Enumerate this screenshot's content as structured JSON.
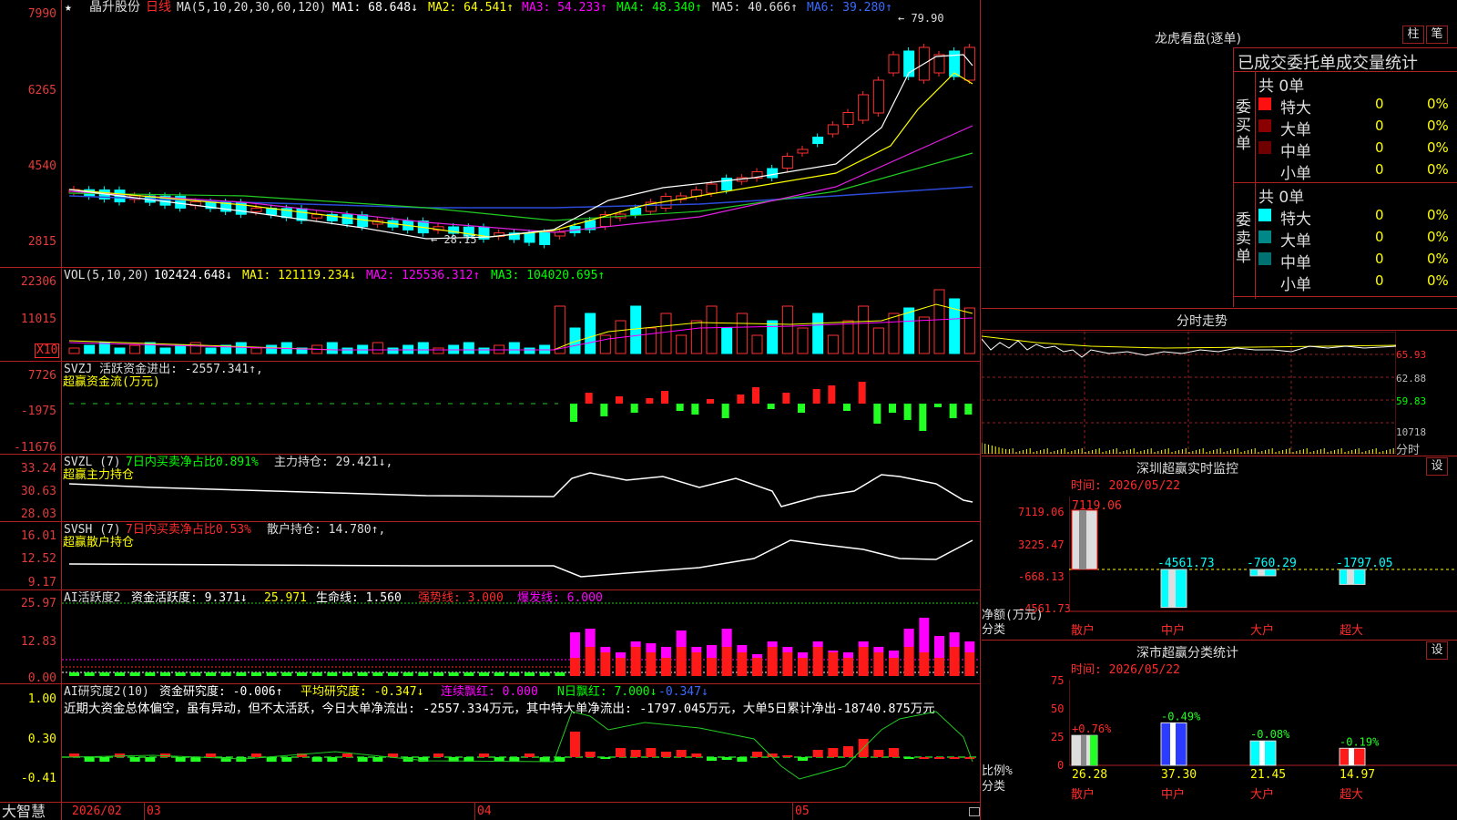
{
  "stock": {
    "name": "晶升股份",
    "period": "日线",
    "star": "★"
  },
  "ma_line": {
    "prefix": "MA(5,10,20,30,60,120)",
    "ma1": "MA1: 68.648↓",
    "ma2": "MA2: 64.541↑",
    "ma3": "MA3: 54.233↑",
    "ma4": "MA4: 48.340↑",
    "ma5": "MA5: 40.666↑",
    "ma6": "MA6: 39.280↑"
  },
  "price_axis": [
    "7990",
    "6265",
    "4540",
    "2815"
  ],
  "price_marks": {
    "high": "79.90",
    "low": "28.15"
  },
  "vol": {
    "header": "VOL(5,10,20)",
    "value": "102424.648↓",
    "ma1": "MA1: 121119.234↓",
    "ma2": "MA2: 125536.312↑",
    "ma3": "MA3: 104020.695↑",
    "axis": [
      "22306",
      "11015"
    ],
    "unit": "X10"
  },
  "svzj": {
    "header": "SVZJ  活跃资金进出: -2557.341↑,",
    "sub": "超赢资金流(万元)",
    "axis": [
      "7726",
      "-1975",
      "-11676"
    ]
  },
  "svzl": {
    "header": "SVZL (7)",
    "ratio": "7日内买卖净占比0.891%",
    "hold": "主力持仓: 29.421↓,",
    "sub": "超赢主力持仓",
    "axis": [
      "33.24",
      "30.63",
      "28.03"
    ]
  },
  "svsh": {
    "header": "SVSH (7)",
    "ratio": "7日内买卖净占比0.53%",
    "hold": "散户持仓: 14.780↑,",
    "sub": "超赢散户持仓",
    "axis": [
      "16.01",
      "12.52",
      "9.17"
    ]
  },
  "ai_active": {
    "header": "AI活跃度2",
    "a": "资金活跃度: 9.371↓",
    "b": "25.971",
    "c": "生命线: 1.560",
    "d": "强势线: 3.000",
    "e": "爆发线: 6.000",
    "axis": [
      "25.97",
      "12.83",
      "0.00"
    ]
  },
  "ai_research": {
    "header": "AI研究度2(10)",
    "a": "资金研究度: -0.006↑",
    "b": "平均研究度: -0.347↓",
    "c": "连续飘红: 0.000",
    "d": "N日飘红: 7.000↓",
    "e": "-0.347↓",
    "comment": "近期大资金总体偏空，虽有异动，但不太活跃，今日大单净流出: -2557.334万元，其中特大单净流出: -1797.045万元，大单5日累计净出-18740.875万元",
    "axis": [
      "1.00",
      "0.30",
      "-0.41"
    ]
  },
  "date_axis": [
    "2026/02",
    "03",
    "04",
    "05"
  ],
  "brand": "大智慧",
  "right": {
    "dragon_title": "龙虎看盘(逐单)",
    "tab_bar": "柱",
    "tab_pen": "笔",
    "tabs_row": "已成交委托单成交量统计",
    "buy_group": "委买单",
    "sell_group": "委卖单",
    "buy_total": "共 0单",
    "sell_total": "共 0单",
    "buy_rows": [
      {
        "label": "特大",
        "v": "0",
        "p": "0%"
      },
      {
        "label": "大单",
        "v": "0",
        "p": "0%"
      },
      {
        "label": "中单",
        "v": "0",
        "p": "0%"
      },
      {
        "label": "小单",
        "v": "0",
        "p": "0%"
      }
    ],
    "sell_rows": [
      {
        "label": "特大",
        "v": "0",
        "p": "0%"
      },
      {
        "label": "大单",
        "v": "0",
        "p": "0%"
      },
      {
        "label": "中单",
        "v": "0",
        "p": "0%"
      },
      {
        "label": "小单",
        "v": "0",
        "p": "0%"
      }
    ],
    "intraday_title": "分时走势",
    "intraday_axis": [
      "65.93",
      "62.88",
      "59.83",
      "10718",
      "分时"
    ],
    "sz_monitor_title": "深圳超赢实时监控",
    "sz_set": "设",
    "sz_time": "时间: 2026/05/22",
    "sz_axis": [
      "7119.06",
      "3225.47",
      "-668.13",
      "-4561.73"
    ],
    "sz_bar_values": [
      "7119.06",
      "-4561.73",
      "-760.29",
      "-1797.05"
    ],
    "sz_ylabel": "净额(万元)",
    "sz_xlabel": "分类",
    "sz_categories": [
      "散户",
      "中户",
      "大户",
      "超大"
    ],
    "cls_title": "深市超赢分类统计",
    "cls_set": "设",
    "cls_time": "时间: 2026/05/22",
    "cls_axis": [
      "75",
      "50",
      "25",
      "0"
    ],
    "cls_top": [
      "+0.76%",
      "-0.49%",
      "-0.08%",
      "-0.19%"
    ],
    "cls_bottom": [
      "26.28",
      "37.30",
      "21.45",
      "14.97"
    ],
    "cls_ylabel": "比例%",
    "cls_xlabel": "分类",
    "cls_categories": [
      "散户",
      "中户",
      "大户",
      "超大"
    ]
  }
}
